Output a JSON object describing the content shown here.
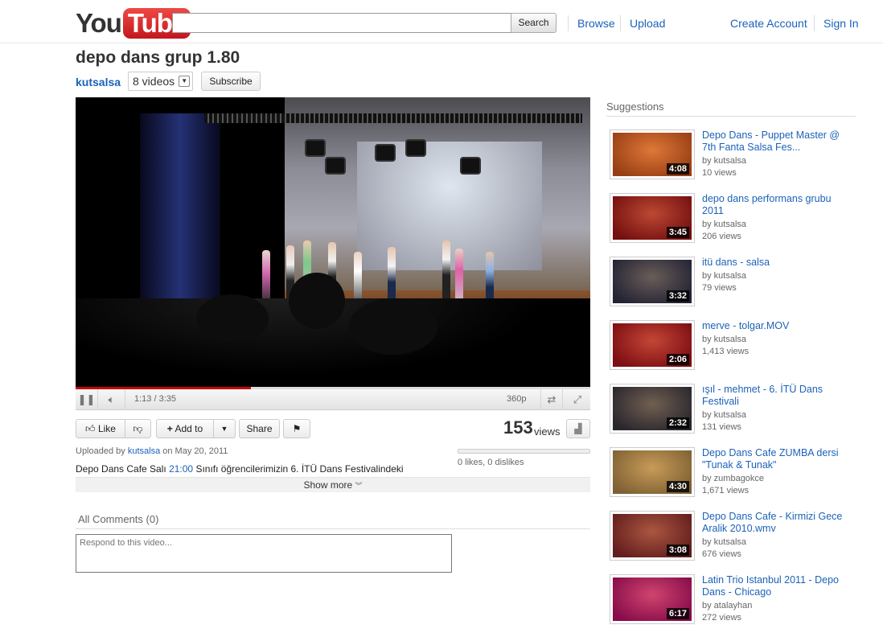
{
  "header": {
    "logo_you": "You",
    "logo_tube": "Tube",
    "search_placeholder": "",
    "search_button": "Search",
    "browse": "Browse",
    "upload": "Upload",
    "create_account": "Create Account",
    "sign_in": "Sign In"
  },
  "video": {
    "title": "depo dans grup 1.80",
    "channel": "kutsalsa",
    "videos_count": "8 videos",
    "subscribe": "Subscribe",
    "time": "1:13 / 3:35",
    "progress": 0.34,
    "quality": "360p"
  },
  "actions": {
    "like": "Like",
    "add_to": "Add to",
    "share": "Share",
    "views_number": "153",
    "views_label": "views",
    "likes_text": "0 likes, 0 dislikes"
  },
  "info": {
    "uploaded_prefix": "Uploaded by",
    "uploaded_user": "kutsalsa",
    "uploaded_date": "on May 20, 2011",
    "desc_before": "Depo Dans Cafe Salı",
    "desc_time": "21:00",
    "desc_after": "Sınıfı öğrencilerimizin 6. İTÜ Dans Festivalindeki",
    "show_more": "Show more"
  },
  "comments": {
    "header": "All Comments (0)",
    "placeholder": "Respond to this video..."
  },
  "sidebar": {
    "header": "Suggestions",
    "items": [
      {
        "title": "Depo Dans - Puppet Master @ 7th Fanta Salsa Fes...",
        "by": "by kutsalsa",
        "views": "10 views",
        "duration": "4:08",
        "color": "#d7581c"
      },
      {
        "title": "depo dans performans grubu 2011",
        "by": "by kutsalsa",
        "views": "206 views",
        "duration": "3:45",
        "color": "#a51515"
      },
      {
        "title": "itü dans - salsa",
        "by": "by kutsalsa",
        "views": "79 views",
        "duration": "3:32",
        "color": "#30324a"
      },
      {
        "title": "merve - tolgar.MOV",
        "by": "by kutsalsa",
        "views": "1,413 views",
        "duration": "2:06",
        "color": "#b0131a"
      },
      {
        "title": "ışıl - mehmet - 6. İTÜ Dans Festivali",
        "by": "by kutsalsa",
        "views": "131 views",
        "duration": "2:32",
        "color": "#3a3640"
      },
      {
        "title": "Depo Dans Cafe ZUMBA dersi \"Tunak & Tunak\"",
        "by": "by zumbagokce",
        "views": "1,671 views",
        "duration": "4:30",
        "color": "#b58a4a"
      },
      {
        "title": "Depo Dans Cafe - Kirmizi Gece Aralik 2010.wmv",
        "by": "by kutsalsa",
        "views": "676 views",
        "duration": "3:08",
        "color": "#8c2a2a"
      },
      {
        "title": "Latin Trio Istanbul 2011 - Depo Dans - Chicago",
        "by": "by atalayhan",
        "views": "272 views",
        "duration": "6:17",
        "color": "#c0106a"
      }
    ]
  }
}
